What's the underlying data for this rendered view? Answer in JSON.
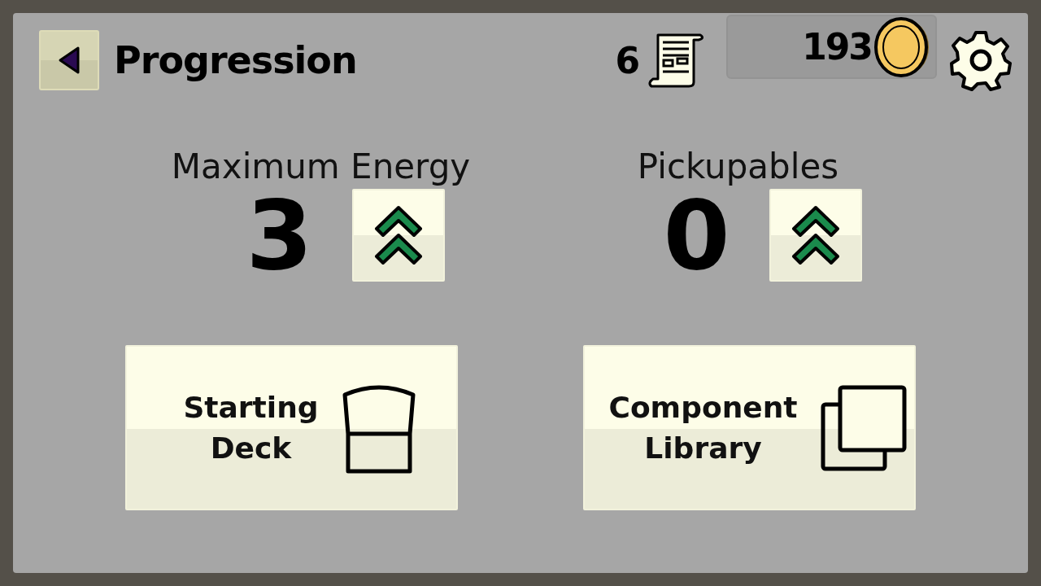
{
  "title": "Progression",
  "scrolls": "6",
  "coins": "193",
  "stats": [
    {
      "label": "Maximum Energy",
      "value": "3"
    },
    {
      "label": "Pickupables",
      "value": "0"
    }
  ],
  "buttons": [
    {
      "label": "Starting Deck",
      "kind": "deck"
    },
    {
      "label": "Component Library",
      "kind": "library"
    }
  ]
}
